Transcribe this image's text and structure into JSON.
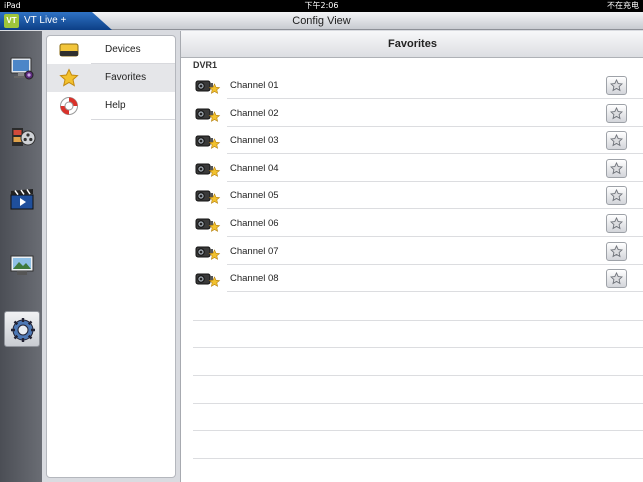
{
  "status_bar": {
    "device": "iPad",
    "time": "下午2:06",
    "battery": "不在充电"
  },
  "app": {
    "logo_text": "VT",
    "name": "VT Live +",
    "title": "Config View"
  },
  "tabs": [
    {
      "name": "live-view",
      "icon": "monitor-camera-icon"
    },
    {
      "name": "playback",
      "icon": "film-reel-icon"
    },
    {
      "name": "video",
      "icon": "clapperboard-icon"
    },
    {
      "name": "snapshot",
      "icon": "picture-frame-icon"
    },
    {
      "name": "config",
      "icon": "settings-gear-icon",
      "selected": true
    }
  ],
  "sidebar": {
    "items": [
      {
        "label": "Devices",
        "icon": "dvr-device-icon"
      },
      {
        "label": "Favorites",
        "icon": "star-icon",
        "selected": true
      },
      {
        "label": "Help",
        "icon": "lifebuoy-icon"
      }
    ]
  },
  "detail": {
    "title": "Favorites",
    "section": "DVR1",
    "channels": [
      {
        "label": "Channel 01"
      },
      {
        "label": "Channel 02"
      },
      {
        "label": "Channel 03"
      },
      {
        "label": "Channel 04"
      },
      {
        "label": "Channel 05"
      },
      {
        "label": "Channel 06"
      },
      {
        "label": "Channel 07"
      },
      {
        "label": "Channel 08"
      }
    ]
  },
  "colors": {
    "accent": "#1e5fb3",
    "star": "#f2c12e",
    "logo": "#9fc63b"
  }
}
